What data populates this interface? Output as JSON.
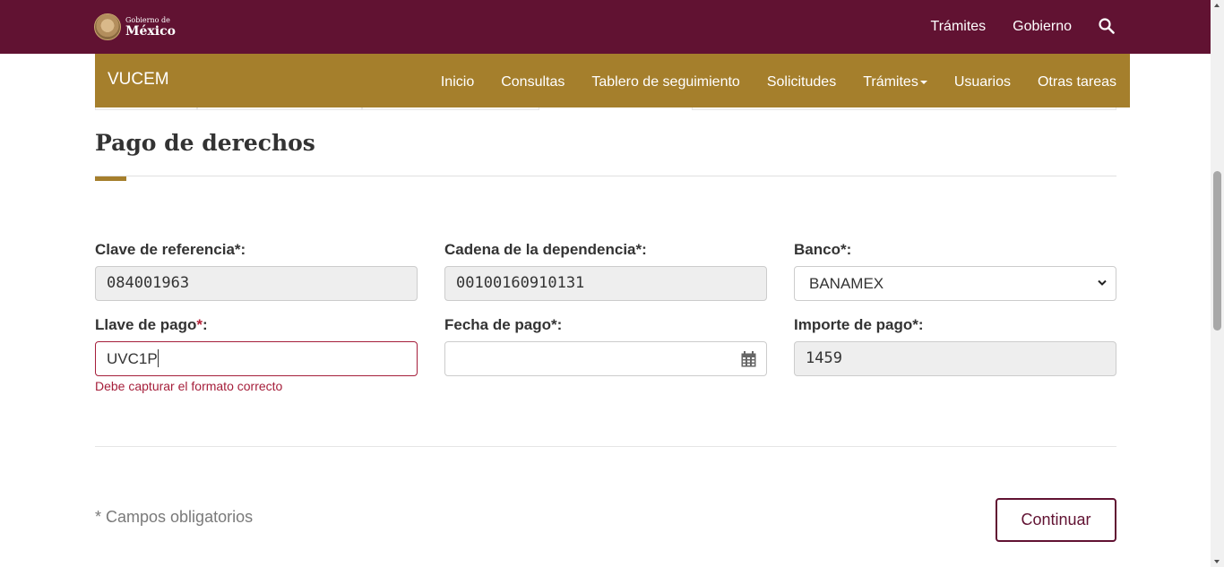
{
  "header": {
    "logo_small": "Gobierno de",
    "logo_big": "México",
    "links": [
      "Trámites",
      "Gobierno"
    ],
    "search_icon": "search-icon",
    "color": "#611232"
  },
  "subnav": {
    "brand": "VUCEM",
    "items": [
      "Inicio",
      "Consultas",
      "Tablero de seguimiento",
      "Solicitudes",
      "Trámites",
      "Usuarios",
      "Otras tareas"
    ],
    "dropdown_item": "Trámites",
    "color": "#a57f2c"
  },
  "page": {
    "title": "Pago de derechos"
  },
  "form": {
    "clave_referencia": {
      "label": "Clave de referencia*:",
      "value": "084001963"
    },
    "cadena_dependencia": {
      "label": "Cadena de la dependencia*:",
      "value": "00100160910131"
    },
    "banco": {
      "label": "Banco*:",
      "value": "BANAMEX"
    },
    "llave_pago": {
      "label": "Llave de pago",
      "label_star": "*",
      "label_colon": ":",
      "value": "UVC1P",
      "error": "Debe capturar el formato correcto"
    },
    "fecha_pago": {
      "label": "Fecha de pago*:",
      "value": ""
    },
    "importe_pago": {
      "label": "Importe de pago*:",
      "value": "1459"
    }
  },
  "footer": {
    "required_note": "* Campos obligatorios",
    "continue_label": "Continuar"
  }
}
